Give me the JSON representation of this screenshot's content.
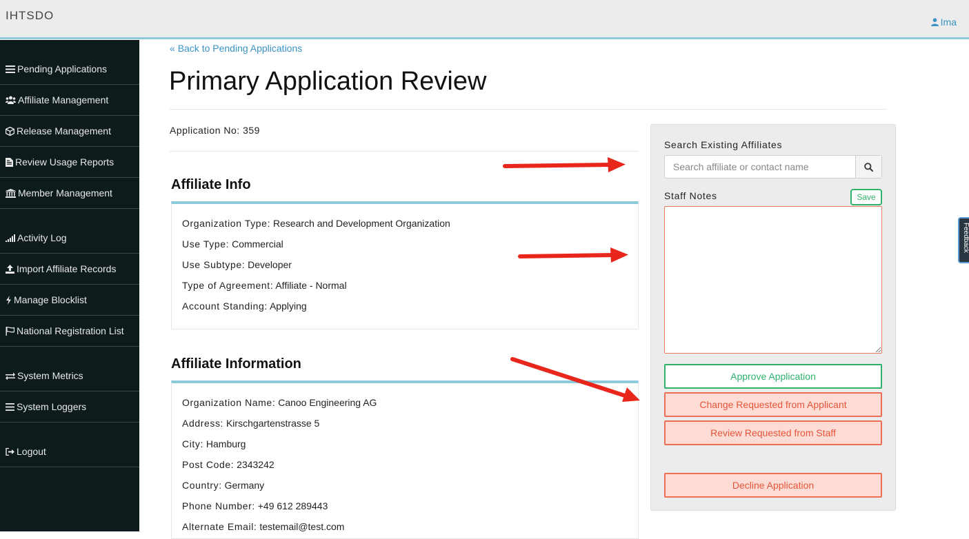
{
  "header": {
    "brand": "IHTSDO",
    "user": "Ima"
  },
  "sidebar": {
    "items": [
      {
        "label": "Pending Applications",
        "icon": "list-icon"
      },
      {
        "label": "Affiliate Management",
        "icon": "users-icon"
      },
      {
        "label": "Release Management",
        "icon": "cube-icon"
      },
      {
        "label": "Review Usage Reports",
        "icon": "file-icon"
      },
      {
        "label": "Member Management",
        "icon": "institution-icon"
      },
      {
        "label": "Activity Log",
        "icon": "signal-icon"
      },
      {
        "label": "Import Affiliate Records",
        "icon": "upload-icon"
      },
      {
        "label": "Manage Blocklist",
        "icon": "bolt-icon"
      },
      {
        "label": "National Registration List",
        "icon": "flag-icon"
      },
      {
        "label": "System Metrics",
        "icon": "exchange-icon"
      },
      {
        "label": "System Loggers",
        "icon": "bars-icon"
      },
      {
        "label": "Logout",
        "icon": "sign-out-icon"
      }
    ]
  },
  "main": {
    "back_link": "Back to Pending Applications",
    "title": "Primary Application Review",
    "application_no_label": "Application No:",
    "application_no": "359",
    "affiliate_info": {
      "heading": "Affiliate Info",
      "fields": [
        {
          "label": "Organization Type:",
          "value": "Research and Development Organization"
        },
        {
          "label": "Use Type:",
          "value": "Commercial"
        },
        {
          "label": "Use Subtype:",
          "value": "Developer"
        },
        {
          "label": "Type of Agreement:",
          "value": "Affiliate - Normal"
        },
        {
          "label": "Account Standing:",
          "value": "Applying"
        }
      ]
    },
    "affiliate_information": {
      "heading": "Affiliate Information",
      "fields": [
        {
          "label": "Organization Name:",
          "value": "Canoo Engineering AG"
        },
        {
          "label": "Address:",
          "value": "Kirschgartenstrasse 5"
        },
        {
          "label": "City:",
          "value": "Hamburg"
        },
        {
          "label": "Post Code:",
          "value": "2343242"
        },
        {
          "label": "Country:",
          "value": "Germany"
        },
        {
          "label": "Phone Number:",
          "value": "+49 612 289443"
        },
        {
          "label": "Alternate Email:",
          "value": "testemail@test.com"
        }
      ]
    }
  },
  "side_panel": {
    "search_label": "Search Existing Affiliates",
    "search_placeholder": "Search affiliate or contact name",
    "notes_label": "Staff Notes",
    "save_label": "Save",
    "approve_label": "Approve Application",
    "change_label": "Change Requested from Applicant",
    "review_label": "Review Requested from Staff",
    "decline_label": "Decline Application"
  },
  "feedback_label": "Feedback",
  "colors": {
    "sidebar_bg": "#0e1b1c",
    "accent": "#8ccbdc",
    "link": "#3a93c4",
    "success": "#2eb26a",
    "danger": "#e6553a",
    "arrow": "#e8261c"
  }
}
